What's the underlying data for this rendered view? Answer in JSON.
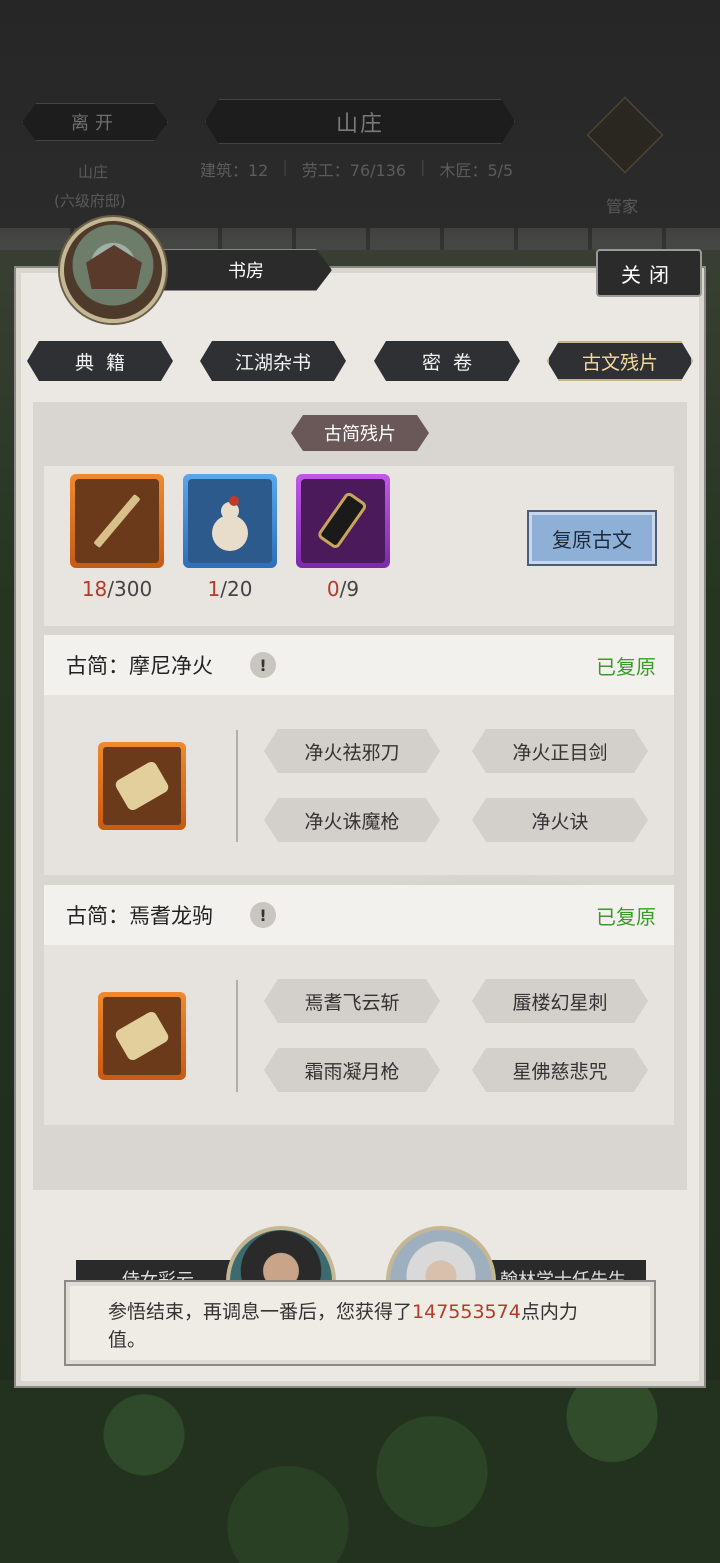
{
  "topbar": {
    "leave_label": "离开",
    "title": "山庄",
    "sub_title": "山庄",
    "sub_level": "(六级府邸)",
    "stats": [
      "建筑：12",
      "劳工：76/136",
      "木匠：5/5"
    ],
    "steward_label": "管家"
  },
  "room": {
    "name": "书房",
    "close_label": "关闭"
  },
  "tabs": [
    {
      "label": "典籍",
      "active": false
    },
    {
      "label": "江湖杂书",
      "active": false
    },
    {
      "label": "密卷",
      "active": false
    },
    {
      "label": "古文残片",
      "active": true
    }
  ],
  "section_title": "古简残片",
  "materials": [
    {
      "name": "bamboo-slip",
      "current": "18",
      "total": "/300",
      "rarity": "orange"
    },
    {
      "name": "gourd",
      "current": "1",
      "total": "/20",
      "rarity": "blue"
    },
    {
      "name": "scroll-case",
      "current": "0",
      "total": "/9",
      "rarity": "purple"
    }
  ],
  "restore_label": "复原古文",
  "groups": [
    {
      "title": "古简：摩尼净火",
      "status": "已复原",
      "skills": [
        "净火祛邪刀",
        "净火正目剑",
        "净火诛魔枪",
        "净火诀"
      ]
    },
    {
      "title": "古简：焉耆龙驹",
      "status": "已复原",
      "skills": [
        "焉耆飞云斩",
        "蜃楼幻星刺",
        "霜雨凝月枪",
        "星佛慈悲咒"
      ]
    }
  ],
  "npcs": [
    {
      "label": "侍女彩云"
    },
    {
      "label": "翰林学士任先生"
    }
  ],
  "toast": {
    "prefix": "参悟结束，再调息一番后，您获得了",
    "value": "147553574",
    "suffix": "点内力值。"
  },
  "colors": {
    "accent_red": "#b23b2a",
    "status_green": "#3a9a2a",
    "active_tab_text": "#f3d9a0"
  }
}
